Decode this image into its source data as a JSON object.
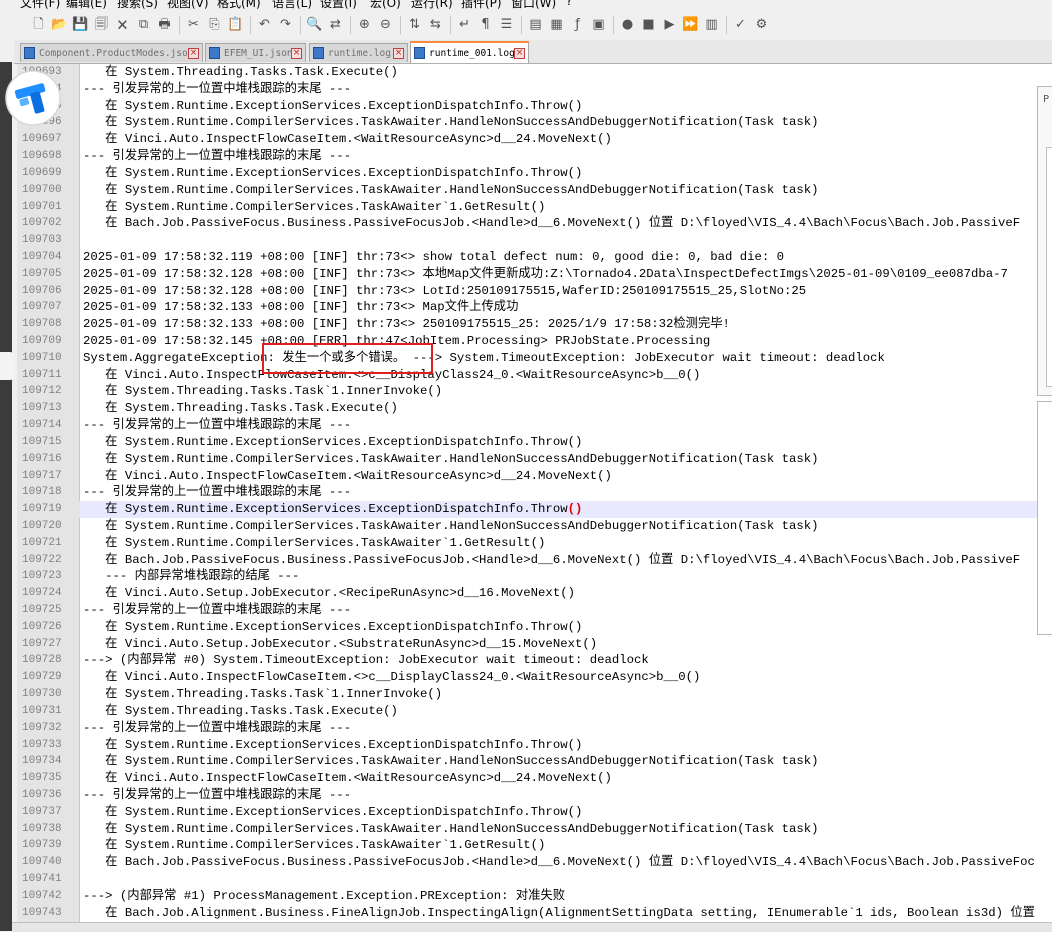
{
  "menu": [
    "文件(F)",
    "编辑(E)",
    "搜索(S)",
    "视图(V)",
    "格式(M)",
    "语言(L)",
    "设置(I)",
    "宏(O)",
    "运行(R)",
    "插件(P)",
    "窗口(W)",
    "?"
  ],
  "toolbar": [
    {
      "name": "new-file-icon",
      "glyph": "🗋"
    },
    {
      "name": "open-file-icon",
      "glyph": "📂"
    },
    {
      "name": "save-icon",
      "glyph": "💾"
    },
    {
      "name": "save-all-icon",
      "glyph": "🗐"
    },
    {
      "name": "close-icon",
      "glyph": "🗙"
    },
    {
      "name": "close-all-icon",
      "glyph": "⧉"
    },
    {
      "name": "print-icon",
      "glyph": "🖶"
    },
    {
      "name": "cut-icon",
      "glyph": "✂"
    },
    {
      "name": "copy-icon",
      "glyph": "⎘"
    },
    {
      "name": "paste-icon",
      "glyph": "📋"
    },
    {
      "name": "undo-icon",
      "glyph": "↶"
    },
    {
      "name": "redo-icon",
      "glyph": "↷"
    },
    {
      "name": "find-icon",
      "glyph": "🔍"
    },
    {
      "name": "replace-icon",
      "glyph": "⇄"
    },
    {
      "name": "zoom-in-icon",
      "glyph": "⊕"
    },
    {
      "name": "zoom-out-icon",
      "glyph": "⊖"
    },
    {
      "name": "sync-vertical-icon",
      "glyph": "⇅"
    },
    {
      "name": "sync-horizontal-icon",
      "glyph": "⇆"
    },
    {
      "name": "word-wrap-icon",
      "glyph": "↵"
    },
    {
      "name": "show-all-chars-icon",
      "glyph": "¶"
    },
    {
      "name": "indent-guide-icon",
      "glyph": "☰"
    },
    {
      "name": "user-defined-language-icon",
      "glyph": "▤"
    },
    {
      "name": "document-map-icon",
      "glyph": "▦"
    },
    {
      "name": "function-list-icon",
      "glyph": "ƒ"
    },
    {
      "name": "folder-workspace-icon",
      "glyph": "▣"
    },
    {
      "name": "record-macro-icon",
      "glyph": "●"
    },
    {
      "name": "stop-recording-icon",
      "glyph": "■"
    },
    {
      "name": "play-macro-icon",
      "glyph": "▶"
    },
    {
      "name": "play-multiple-icon",
      "glyph": "⏩"
    },
    {
      "name": "save-macro-icon",
      "glyph": "▥"
    },
    {
      "name": "spell-check-icon",
      "glyph": "✓"
    },
    {
      "name": "spell-options-icon",
      "glyph": "⚙"
    }
  ],
  "tabs": [
    {
      "label": "Component.ProductModes.json",
      "active": false
    },
    {
      "label": "EFEM_UI.json",
      "active": false
    },
    {
      "label": "runtime.log",
      "active": false
    },
    {
      "label": "runtime_001.log",
      "active": true
    }
  ],
  "side_panel": {
    "label": "P"
  },
  "editor": {
    "current_line": "109719",
    "lines": [
      {
        "n": "109693",
        "text": "   在 System.Threading.Tasks.Task.Execute()"
      },
      {
        "n": "109694",
        "text": "--- 引发异常的上一位置中堆栈跟踪的末尾 ---"
      },
      {
        "n": "109695",
        "text": "   在 System.Runtime.ExceptionServices.ExceptionDispatchInfo.Throw()"
      },
      {
        "n": "109696",
        "text": "   在 System.Runtime.CompilerServices.TaskAwaiter.HandleNonSuccessAndDebuggerNotification(Task task)"
      },
      {
        "n": "109697",
        "text": "   在 Vinci.Auto.InspectFlowCaseItem.<WaitResourceAsync>d__24.MoveNext()"
      },
      {
        "n": "109698",
        "text": "--- 引发异常的上一位置中堆栈跟踪的末尾 ---"
      },
      {
        "n": "109699",
        "text": "   在 System.Runtime.ExceptionServices.ExceptionDispatchInfo.Throw()"
      },
      {
        "n": "109700",
        "text": "   在 System.Runtime.CompilerServices.TaskAwaiter.HandleNonSuccessAndDebuggerNotification(Task task)"
      },
      {
        "n": "109701",
        "text": "   在 System.Runtime.CompilerServices.TaskAwaiter`1.GetResult()"
      },
      {
        "n": "109702",
        "text": "   在 Bach.Job.PassiveFocus.Business.PassiveFocusJob.<Handle>d__6.MoveNext() 位置 D:\\floyed\\VIS_4.4\\Bach\\Focus\\Bach.Job.PassiveF"
      },
      {
        "n": "109703",
        "text": ""
      },
      {
        "n": "109704",
        "text": "2025-01-09 17:58:32.119 +08:00 [INF] thr:73<> show total defect num: 0, good die: 0, bad die: 0"
      },
      {
        "n": "109705",
        "text": "2025-01-09 17:58:32.128 +08:00 [INF] thr:73<> 本地Map文件更新成功:Z:\\Tornado4.2Data\\InspectDefectImgs\\2025-01-09\\0109_ee087dba-7"
      },
      {
        "n": "109706",
        "text": "2025-01-09 17:58:32.128 +08:00 [INF] thr:73<> LotId:250109175515,WaferID:250109175515_25,SlotNo:25"
      },
      {
        "n": "109707",
        "text": "2025-01-09 17:58:32.133 +08:00 [INF] thr:73<> Map文件上传成功"
      },
      {
        "n": "109708",
        "text": "2025-01-09 17:58:32.133 +08:00 [INF] thr:73<> 250109175515_25: 2025/1/9 17:58:32检测完毕!"
      },
      {
        "n": "109709",
        "text": "2025-01-09 17:58:32.145 +08:00 [ERR] thr:47<JobItem.Processing> PRJobState.Processing"
      },
      {
        "n": "109710",
        "text": "System.AggregateException: 发生一个或多个错误。 ---> System.TimeoutException: JobExecutor wait timeout: deadlock"
      },
      {
        "n": "109711",
        "text": "   在 Vinci.Auto.InspectFlowCaseItem.<>c__DisplayClass24_0.<WaitResourceAsync>b__0()"
      },
      {
        "n": "109712",
        "text": "   在 System.Threading.Tasks.Task`1.InnerInvoke()"
      },
      {
        "n": "109713",
        "text": "   在 System.Threading.Tasks.Task.Execute()"
      },
      {
        "n": "109714",
        "text": "--- 引发异常的上一位置中堆栈跟踪的末尾 ---"
      },
      {
        "n": "109715",
        "text": "   在 System.Runtime.ExceptionServices.ExceptionDispatchInfo.Throw()"
      },
      {
        "n": "109716",
        "text": "   在 System.Runtime.CompilerServices.TaskAwaiter.HandleNonSuccessAndDebuggerNotification(Task task)"
      },
      {
        "n": "109717",
        "text": "   在 Vinci.Auto.InspectFlowCaseItem.<WaitResourceAsync>d__24.MoveNext()"
      },
      {
        "n": "109718",
        "text": "--- 引发异常的上一位置中堆栈跟踪的末尾 ---"
      },
      {
        "n": "109719",
        "text": "   在 System.Runtime.ExceptionServices.ExceptionDispatchInfo.Throw()"
      },
      {
        "n": "109720",
        "text": "   在 System.Runtime.CompilerServices.TaskAwaiter.HandleNonSuccessAndDebuggerNotification(Task task)"
      },
      {
        "n": "109721",
        "text": "   在 System.Runtime.CompilerServices.TaskAwaiter`1.GetResult()"
      },
      {
        "n": "109722",
        "text": "   在 Bach.Job.PassiveFocus.Business.PassiveFocusJob.<Handle>d__6.MoveNext() 位置 D:\\floyed\\VIS_4.4\\Bach\\Focus\\Bach.Job.PassiveF"
      },
      {
        "n": "109723",
        "text": "   --- 内部异常堆栈跟踪的结尾 ---"
      },
      {
        "n": "109724",
        "text": "   在 Vinci.Auto.Setup.JobExecutor.<RecipeRunAsync>d__16.MoveNext()"
      },
      {
        "n": "109725",
        "text": "--- 引发异常的上一位置中堆栈跟踪的末尾 ---"
      },
      {
        "n": "109726",
        "text": "   在 System.Runtime.ExceptionServices.ExceptionDispatchInfo.Throw()"
      },
      {
        "n": "109727",
        "text": "   在 Vinci.Auto.Setup.JobExecutor.<SubstrateRunAsync>d__15.MoveNext()"
      },
      {
        "n": "109728",
        "text": "---> (内部异常 #0) System.TimeoutException: JobExecutor wait timeout: deadlock"
      },
      {
        "n": "109729",
        "text": "   在 Vinci.Auto.InspectFlowCaseItem.<>c__DisplayClass24_0.<WaitResourceAsync>b__0()"
      },
      {
        "n": "109730",
        "text": "   在 System.Threading.Tasks.Task`1.InnerInvoke()"
      },
      {
        "n": "109731",
        "text": "   在 System.Threading.Tasks.Task.Execute()"
      },
      {
        "n": "109732",
        "text": "--- 引发异常的上一位置中堆栈跟踪的末尾 ---"
      },
      {
        "n": "109733",
        "text": "   在 System.Runtime.ExceptionServices.ExceptionDispatchInfo.Throw()"
      },
      {
        "n": "109734",
        "text": "   在 System.Runtime.CompilerServices.TaskAwaiter.HandleNonSuccessAndDebuggerNotification(Task task)"
      },
      {
        "n": "109735",
        "text": "   在 Vinci.Auto.InspectFlowCaseItem.<WaitResourceAsync>d__24.MoveNext()"
      },
      {
        "n": "109736",
        "text": "--- 引发异常的上一位置中堆栈跟踪的末尾 ---"
      },
      {
        "n": "109737",
        "text": "   在 System.Runtime.ExceptionServices.ExceptionDispatchInfo.Throw()"
      },
      {
        "n": "109738",
        "text": "   在 System.Runtime.CompilerServices.TaskAwaiter.HandleNonSuccessAndDebuggerNotification(Task task)"
      },
      {
        "n": "109739",
        "text": "   在 System.Runtime.CompilerServices.TaskAwaiter`1.GetResult()"
      },
      {
        "n": "109740",
        "text": "   在 Bach.Job.PassiveFocus.Business.PassiveFocusJob.<Handle>d__6.MoveNext() 位置 D:\\floyed\\VIS_4.4\\Bach\\Focus\\Bach.Job.PassiveFoc"
      },
      {
        "n": "109741",
        "text": ""
      },
      {
        "n": "109742",
        "text": "---> (内部异常 #1) ProcessManagement.Exception.PRException: 对准失败"
      },
      {
        "n": "109743",
        "text": "   在 Bach.Job.Alignment.Business.FineAlignJob.InspectingAlign(AlignmentSettingData setting, IEnumerable`1 ids, Boolean is3d) 位置"
      }
    ]
  },
  "colors": {
    "annotation": "#e02020",
    "current_line": "#e8e8ff",
    "active_tab_accent": "#fa8c3c",
    "logo_blue": "#1f8fff"
  }
}
